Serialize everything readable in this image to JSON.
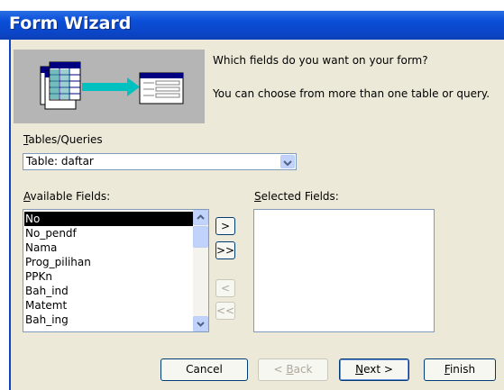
{
  "window": {
    "title": "Form Wizard"
  },
  "description": {
    "line1": "Which fields do you want on your form?",
    "line2": "You can choose from more than one table or query."
  },
  "tables_queries": {
    "label_u": "T",
    "label_rest": "ables/Queries",
    "selected": "Table: daftar"
  },
  "available": {
    "label_u": "A",
    "label_rest": "vailable Fields:",
    "items": [
      "No",
      "No_pendf",
      "Nama",
      "Prog_pilihan",
      "PPKn",
      "Bah_ind",
      "Matemt",
      "Bah_ing"
    ],
    "selected_index": 0
  },
  "selected_fields": {
    "label_u": "S",
    "label_rest": "elected Fields:"
  },
  "move_buttons": {
    "add_one": ">",
    "add_all": ">>",
    "remove_one": "<",
    "remove_all": "<<"
  },
  "footer": {
    "cancel": "Cancel",
    "back_pre": "< ",
    "back_u": "B",
    "back_rest": "ack",
    "next_u": "N",
    "next_rest": "ext >",
    "finish_u": "F",
    "finish_rest": "inish"
  },
  "colors": {
    "title_bar": "#0b46c8",
    "dialog_bg": "#ece9d8",
    "selection": "#000000"
  }
}
